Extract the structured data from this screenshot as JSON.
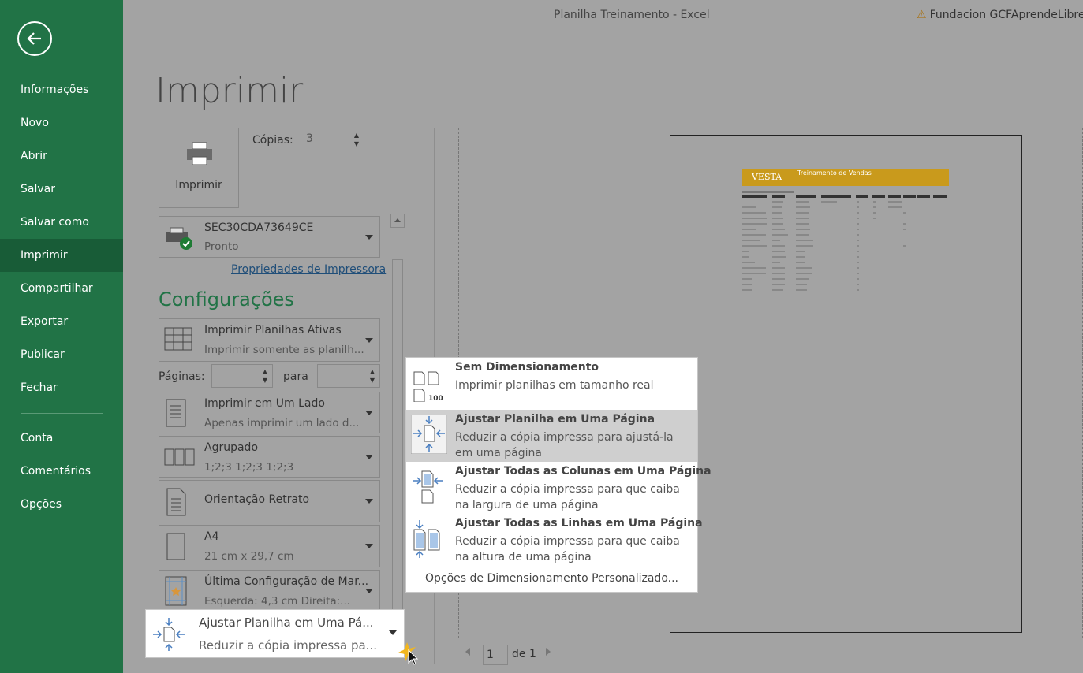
{
  "window": {
    "title": "Planilha Treinamento  -  Excel",
    "user": "Fundacion GCFAprendeLibre"
  },
  "sidebar": {
    "items": [
      "Informações",
      "Novo",
      "Abrir",
      "Salvar",
      "Salvar como",
      "Imprimir",
      "Compartilhar",
      "Exportar",
      "Publicar",
      "Fechar"
    ],
    "items2": [
      "Conta",
      "Comentários",
      "Opções"
    ],
    "active": "Imprimir"
  },
  "print": {
    "title": "Imprimir",
    "button_label": "Imprimir",
    "copies_label": "Cópias:",
    "copies_value": "3",
    "printer_name": "SEC30CDA73649CE",
    "printer_status": "Pronto",
    "printer_properties": "Propriedades de Impressora",
    "settings_title": "Configurações",
    "what": {
      "title": "Imprimir Planilhas Ativas",
      "sub": "Imprimir somente as planilh..."
    },
    "pages_label": "Páginas:",
    "to_label": "para",
    "sides": {
      "title": "Imprimir em Um Lado",
      "sub": "Apenas imprimir um lado d..."
    },
    "collate": {
      "title": "Agrupado",
      "sub": "1;2;3    1;2;3    1;2;3"
    },
    "orientation": {
      "title": "Orientação Retrato"
    },
    "paper": {
      "title": "A4",
      "sub": "21 cm x 29,7 cm"
    },
    "margins": {
      "title": "Última Configuração de Mar...",
      "sub": "Esquerda:  4,3 cm    Direita:..."
    },
    "scaling": {
      "title": "Ajustar Planilha em Uma Pá...",
      "sub": "Reduzir a cópia impressa pa..."
    }
  },
  "scaling_menu": {
    "options": [
      {
        "title": "Sem Dimensionamento",
        "desc": "Imprimir planilhas em tamanho real",
        "icon": "no-scaling-icon"
      },
      {
        "title": "Ajustar Planilha em Uma Página",
        "desc": "Reduzir a cópia impressa para ajustá-la em uma página",
        "icon": "fit-sheet-icon"
      },
      {
        "title": "Ajustar Todas as Colunas em Uma Página",
        "desc": "Reduzir a cópia impressa para que caiba na largura de uma página",
        "icon": "fit-columns-icon"
      },
      {
        "title": "Ajustar Todas as Linhas em Uma Página",
        "desc": "Reduzir a cópia impressa para que caiba na altura de uma página",
        "icon": "fit-rows-icon"
      }
    ],
    "custom": "Opções de Dimensionamento Personalizado..."
  },
  "preview": {
    "brand": "VESTA",
    "subtitle": "Treinamento de Vendas",
    "page_current": "1",
    "page_of": "de 1"
  }
}
